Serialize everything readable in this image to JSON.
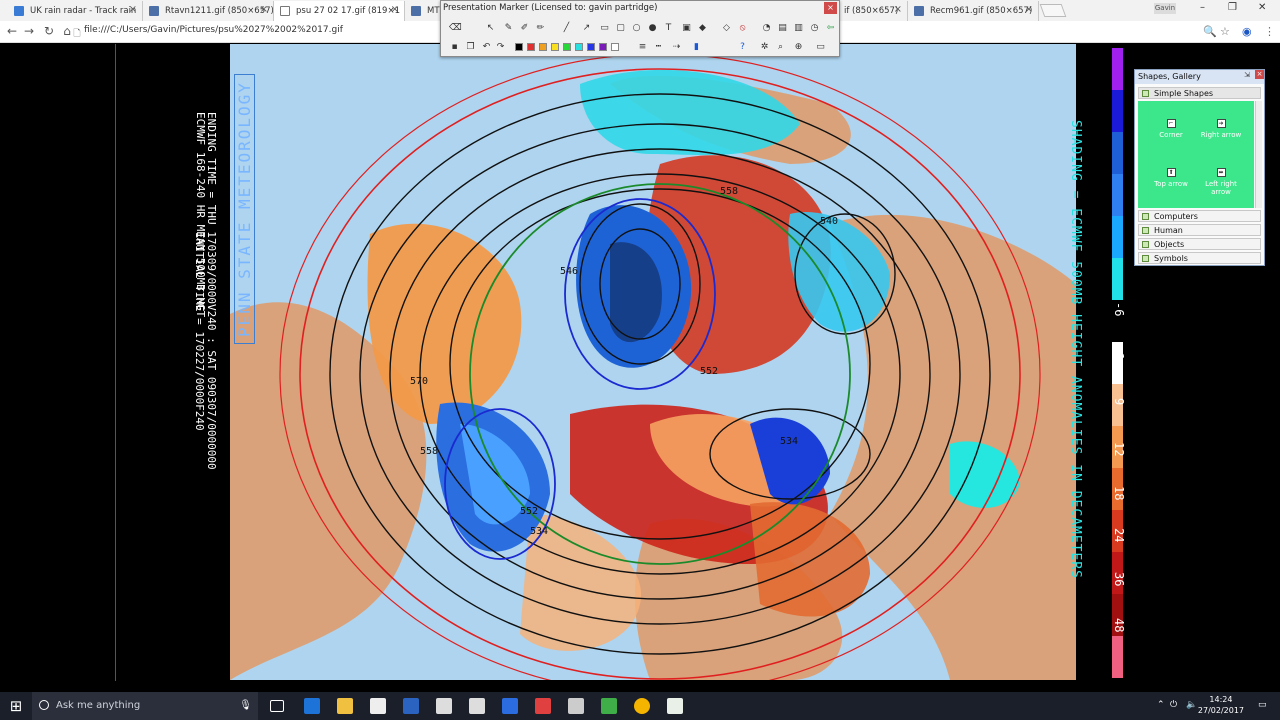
{
  "tabs": [
    {
      "title": "UK rain radar - Track rain",
      "active": false
    },
    {
      "title": "Rtavn1211.gif (850×657)",
      "active": false
    },
    {
      "title": "psu 27 02 17.gif (819×1",
      "active": true
    },
    {
      "title": "MT8_U",
      "active": false
    },
    {
      "title": "if (850×657)",
      "active": false
    },
    {
      "title": "Recm961.gif (850×657)",
      "active": false
    }
  ],
  "window": {
    "user": "Gavin",
    "minimize": "–",
    "maximize": "❐",
    "close": "✕"
  },
  "address": {
    "url": "file:///C:/Users/Gavin/Pictures/psu%2027%2002%2017.gif"
  },
  "toolbar": {
    "title": "Presentation Marker (Licensed to: gavin partridge)",
    "close": "×",
    "swatches": [
      "#000000",
      "#e03030",
      "#f0a020",
      "#f8e020",
      "#28d838",
      "#28e0e0",
      "#2838e8",
      "#7a1ab8",
      "#ffffff"
    ]
  },
  "map": {
    "penn_label": "PENN STATE METEOROLOGY",
    "caption_line1": "ECMWF 168-240 HR MEAN 500MB HGT",
    "caption_line2": "ENDING TIME = THU 170309/0000V240 : SAT 090307/0000000",
    "caption_line3": "INITIAL TIME = 170227/0000F240",
    "shading_label": "SHADING = ECMWF 500MB HEIGHT ANOMALIES IN DECAMETERS",
    "contour_labels": [
      "558",
      "552",
      "546",
      "570",
      "558",
      "552",
      "540",
      "534",
      "534"
    ],
    "scale_labels": [
      "-6",
      "6",
      "9",
      "12",
      "18",
      "24",
      "36",
      "48"
    ],
    "scale_colors": [
      "#a020f0",
      "#1a1ad8",
      "#1e5fd8",
      "#2f7ff0",
      "#1aa8ff",
      "#22e0e8",
      "#000000",
      "#ffffff",
      "#f8c090",
      "#f49a50",
      "#e86a2c",
      "#d83a20",
      "#c01818",
      "#a01010",
      "#f06080"
    ]
  },
  "gallery": {
    "title": "Shapes, Gallery",
    "selected_category": "Simple Shapes",
    "items": [
      {
        "label": "Corner",
        "icon": "corner-icon"
      },
      {
        "label": "Right arrow",
        "icon": "right-arrow-icon"
      },
      {
        "label": "Top arrow",
        "icon": "top-arrow-icon"
      },
      {
        "label": "Left right arrow",
        "icon": "left-right-arrow-icon"
      }
    ],
    "categories": [
      "Computers",
      "Human",
      "Objects",
      "Symbols"
    ]
  },
  "taskbar": {
    "search_placeholder": "Ask me anything",
    "time": "14:24",
    "date": "27/02/2017"
  }
}
